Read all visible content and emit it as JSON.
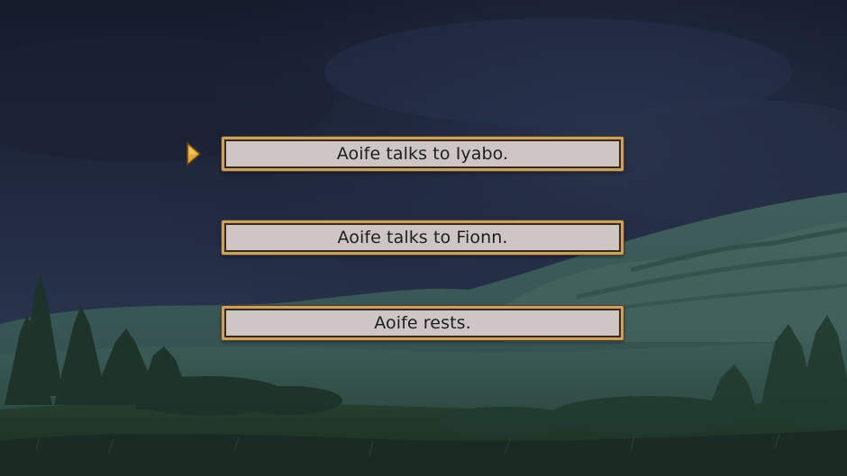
{
  "scene": {
    "description_icon": "night-meadow-background",
    "colors": {
      "sky_top": "#171d2e",
      "sky_mid": "#26314a",
      "hills": "#3a5a55",
      "field": "#2c4840",
      "choice_frame": "#c8a169",
      "choice_fill": "#cdc6c4",
      "cursor": "#e0a83a"
    }
  },
  "menu": {
    "selected_index": 0,
    "cursor_icon": "selection-arrow-icon",
    "choices": [
      {
        "label": "Aoife talks to Iyabo."
      },
      {
        "label": "Aoife talks to Fionn."
      },
      {
        "label": "Aoife rests."
      }
    ]
  }
}
